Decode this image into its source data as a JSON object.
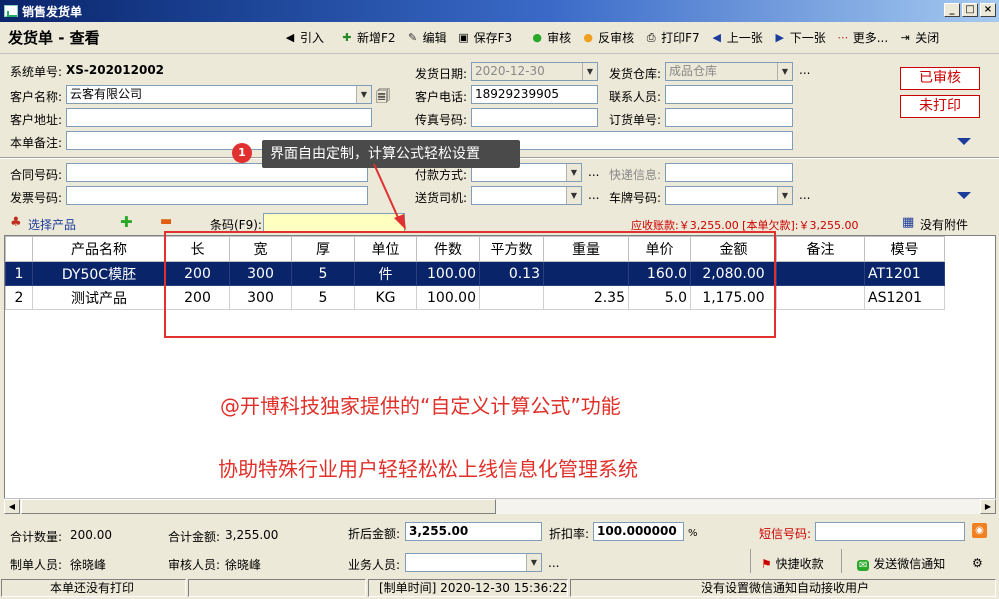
{
  "window": {
    "title": "销售发货单",
    "min": "_",
    "max": "□",
    "close": "×"
  },
  "toolbar": {
    "page_title": "发货单 - 查看",
    "buttons": [
      {
        "icon": "import-arrow-icon",
        "glyph": "◀",
        "label": "引入"
      },
      {
        "icon": "new-doc-icon",
        "glyph": "✚",
        "label": "新增F2"
      },
      {
        "icon": "edit-icon",
        "glyph": "✎",
        "label": "编辑"
      },
      {
        "icon": "save-icon",
        "glyph": "▣",
        "label": "保存F3"
      },
      {
        "icon": "audit-icon",
        "glyph": "●",
        "label": "审核"
      },
      {
        "icon": "unaudit-icon",
        "glyph": "●",
        "label": "反审核"
      },
      {
        "icon": "print-icon",
        "glyph": "⎙",
        "label": "打印F7"
      },
      {
        "icon": "prev-icon",
        "glyph": "◀",
        "label": "上一张"
      },
      {
        "icon": "next-icon",
        "glyph": "▶",
        "label": "下一张"
      },
      {
        "icon": "more-icon",
        "glyph": "⋯",
        "label": "更多..."
      },
      {
        "icon": "close-icon",
        "glyph": "⇥",
        "label": "关闭"
      }
    ]
  },
  "form": {
    "sys_no_label": "系统单号:",
    "sys_no": "XS-202012002",
    "customer_label": "客户名称:",
    "customer": "云客有限公司",
    "address_label": "客户地址:",
    "address": "",
    "remark_label": "本单备注:",
    "remark": "",
    "ship_date_label": "发货日期:",
    "ship_date": "2020-12-30",
    "phone_label": "客户电话:",
    "phone": "18929239905",
    "fax_label": "传真号码:",
    "fax": "",
    "warehouse_label": "发货仓库:",
    "warehouse": "成品仓库",
    "contact_label": "联系人员:",
    "contact": "",
    "order_no_label": "订货单号:",
    "order_no": "",
    "contract_label": "合同号码:",
    "contract": "",
    "invoice_label": "发票号码:",
    "invoice": "",
    "payment_label": "付款方式:",
    "payment": "",
    "driver_label": "送货司机:",
    "driver": "",
    "express_label": "快递信息:",
    "express": "",
    "plate_label": "车牌号码:",
    "plate": "",
    "ellipsis": "...",
    "status_audited": "已审核",
    "status_print": "未打印"
  },
  "tooltip": {
    "badge": "1",
    "text": "界面自由定制，计算公式轻松设置"
  },
  "products": {
    "select_label": "选择产品",
    "add_glyph": "✚",
    "remove_glyph": "▬",
    "barcode_label": "条码(F9):",
    "barcode_value": "",
    "receivable": "应收账款:￥3,255.00 [本单欠款]:￥3,255.00",
    "attachments": "没有附件"
  },
  "grid": {
    "columns": [
      "",
      "产品名称",
      "长",
      "宽",
      "厚",
      "单位",
      "件数",
      "平方数",
      "重量",
      "单价",
      "金额",
      "备注",
      "模号"
    ],
    "rows": [
      [
        "1",
        "DY50C模胚",
        "200",
        "300",
        "5",
        "件",
        "100.00",
        "0.13",
        "",
        "160.0",
        "2,080.00",
        "",
        "AT1201"
      ],
      [
        "2",
        "测试产品",
        "200",
        "300",
        "5",
        "KG",
        "100.00",
        "",
        "2.35",
        "5.0",
        "1,175.00",
        "",
        "AS1201"
      ]
    ]
  },
  "promo": {
    "line1": "@开博科技独家提供的“自定义计算公式”功能",
    "line2": "协助特殊行业用户轻轻松松上线信息化管理系统"
  },
  "summary": {
    "total_qty_label": "合计数量:",
    "total_qty": "200.00",
    "total_amount_label": "合计金额:",
    "total_amount": "3,255.00",
    "discounted_label": "折后金额:",
    "discounted": "3,255.00",
    "discount_rate_label": "折扣率:",
    "discount_rate": "100.000000",
    "percent": "%",
    "sms_label": "短信号码:",
    "sms": "",
    "maker_label": "制单人员:",
    "maker": "徐晓峰",
    "auditor_label": "审核人员:",
    "auditor": "徐晓峰",
    "salesman_label": "业务人员:",
    "salesman": "",
    "quick_pay": "快捷收款",
    "wechat": "发送微信通知"
  },
  "status": {
    "print": "本单还没有打印",
    "time": "[制单时间] 2020-12-30 15:36:22",
    "wechat": "没有设置微信通知自动接收用户"
  },
  "colors": {
    "accent": "#0a246a",
    "promo_red": "#e0302a",
    "selection": "#0a246a"
  }
}
